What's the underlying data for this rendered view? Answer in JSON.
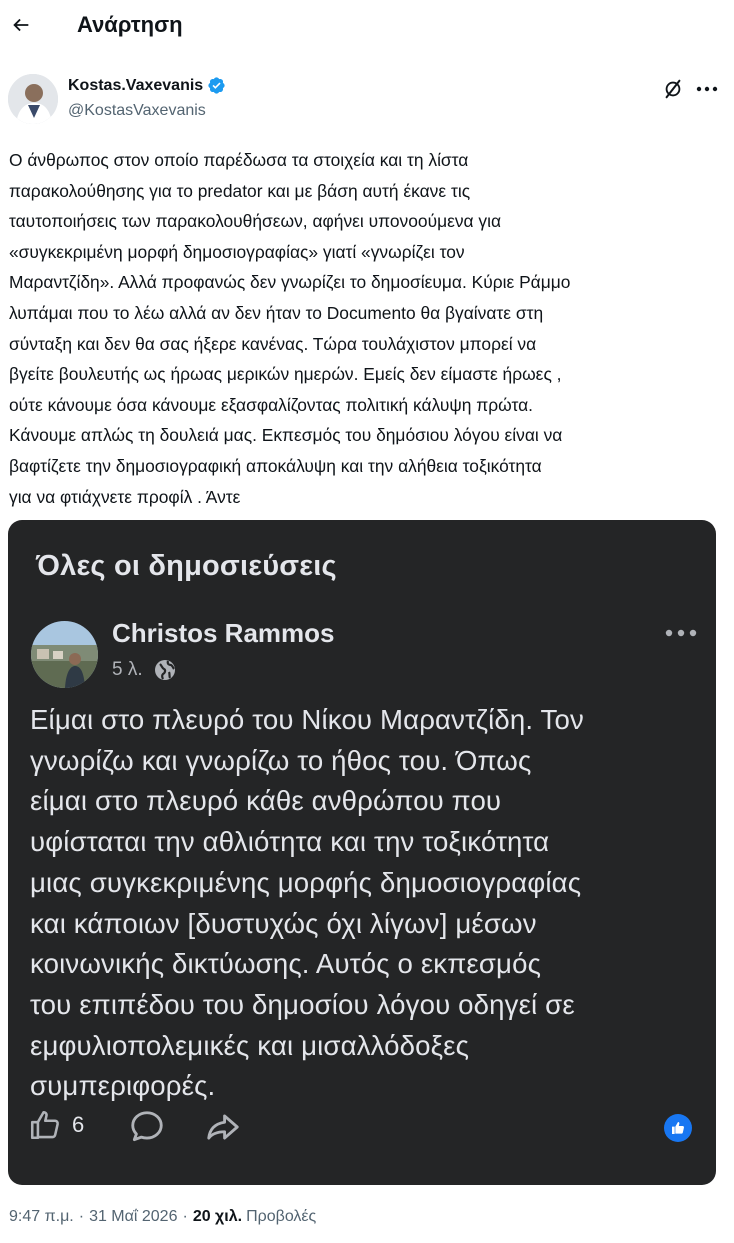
{
  "header": {
    "title": "Ανάρτηση"
  },
  "author": {
    "name": "Kostas.Vaxevanis",
    "handle": "@KostasVaxevanis",
    "verified_color": "#1d9bf0"
  },
  "post": {
    "text": "Ο άνθρωπος στον οποίο παρέδωσα τα στοιχεία και τη λίστα\nπαρακολούθησης για το predator και με βάση αυτή έκανε τις\nταυτοποιήσεις των παρακολουθήσεων, αφήνει υπονοούμενα για\n«συγκεκριμένη μορφή δημοσιογραφίας» γιατί «γνωρίζει τον\nΜαραντζίδη». Αλλά προφανώς δεν γνωρίζει το δημοσίευμα. Κύριε Ράμμο\nλυπάμαι που το λέω αλλά αν δεν ήταν το Documento θα βγαίνατε στη\nσύνταξη και δεν θα σας ήξερε κανένας. Τώρα τουλάχιστον μπορεί να\nβγείτε βουλευτής ως ήρωας μερικών ημερών. Εμείς δεν είμαστε ήρωες ,\nούτε κάνουμε όσα κάνουμε εξασφαλίζοντας πολιτική κάλυψη πρώτα.\nΚάνουμε απλώς τη δουλειά μας.  Εκπεσμός του δημόσιου λόγου είναι να\nβαφτίζετε την δημοσιογραφική αποκάλυψη και την αλήθεια τοξικότητα\nγια να φτιάχνετε προφίλ . Άντε",
    "time": "9:47 π.μ.",
    "separator": "·",
    "date": "31 Μαΐ 2026",
    "views_count": "20 χιλ.",
    "views_label": "Προβολές"
  },
  "embed": {
    "header": "Όλες οι δημοσιεύσεις",
    "author": "Christos Rammos",
    "age": "5 λ.",
    "text": "Είμαι στο πλευρό του Νίκου Μαραντζίδη. Τον\nγνωρίζω και γνωρίζω το ήθος του. Όπως\nείμαι στο πλευρό κάθε ανθρώπου που\nυφίσταται την αθλιότητα και την τοξικότητα\nμιας  συγκεκριμένης μορφής δημοσιογραφίας\nκαι κάποιων [δυστυχώς όχι λίγων] μέσων\nκοινωνικής δικτύωσης. Αυτός ο εκπεσμός\nτου επιπέδου του δημοσίου λόγου οδηγεί σε\nεμφυλιοπολεμικές και μισαλλόδοξες\nσυμπεριφορές.",
    "likes": "6",
    "background_color": "#242526",
    "reaction_color": "#1877f2"
  },
  "icons": {
    "back": "arrow-left-icon",
    "verified": "verified-badge-icon",
    "grok": "grok-icon",
    "more": "more-horizontal-icon",
    "globe": "globe-icon",
    "like": "thumbs-up-icon",
    "comment": "comment-icon",
    "share": "share-icon",
    "reaction": "like-reaction-icon"
  }
}
